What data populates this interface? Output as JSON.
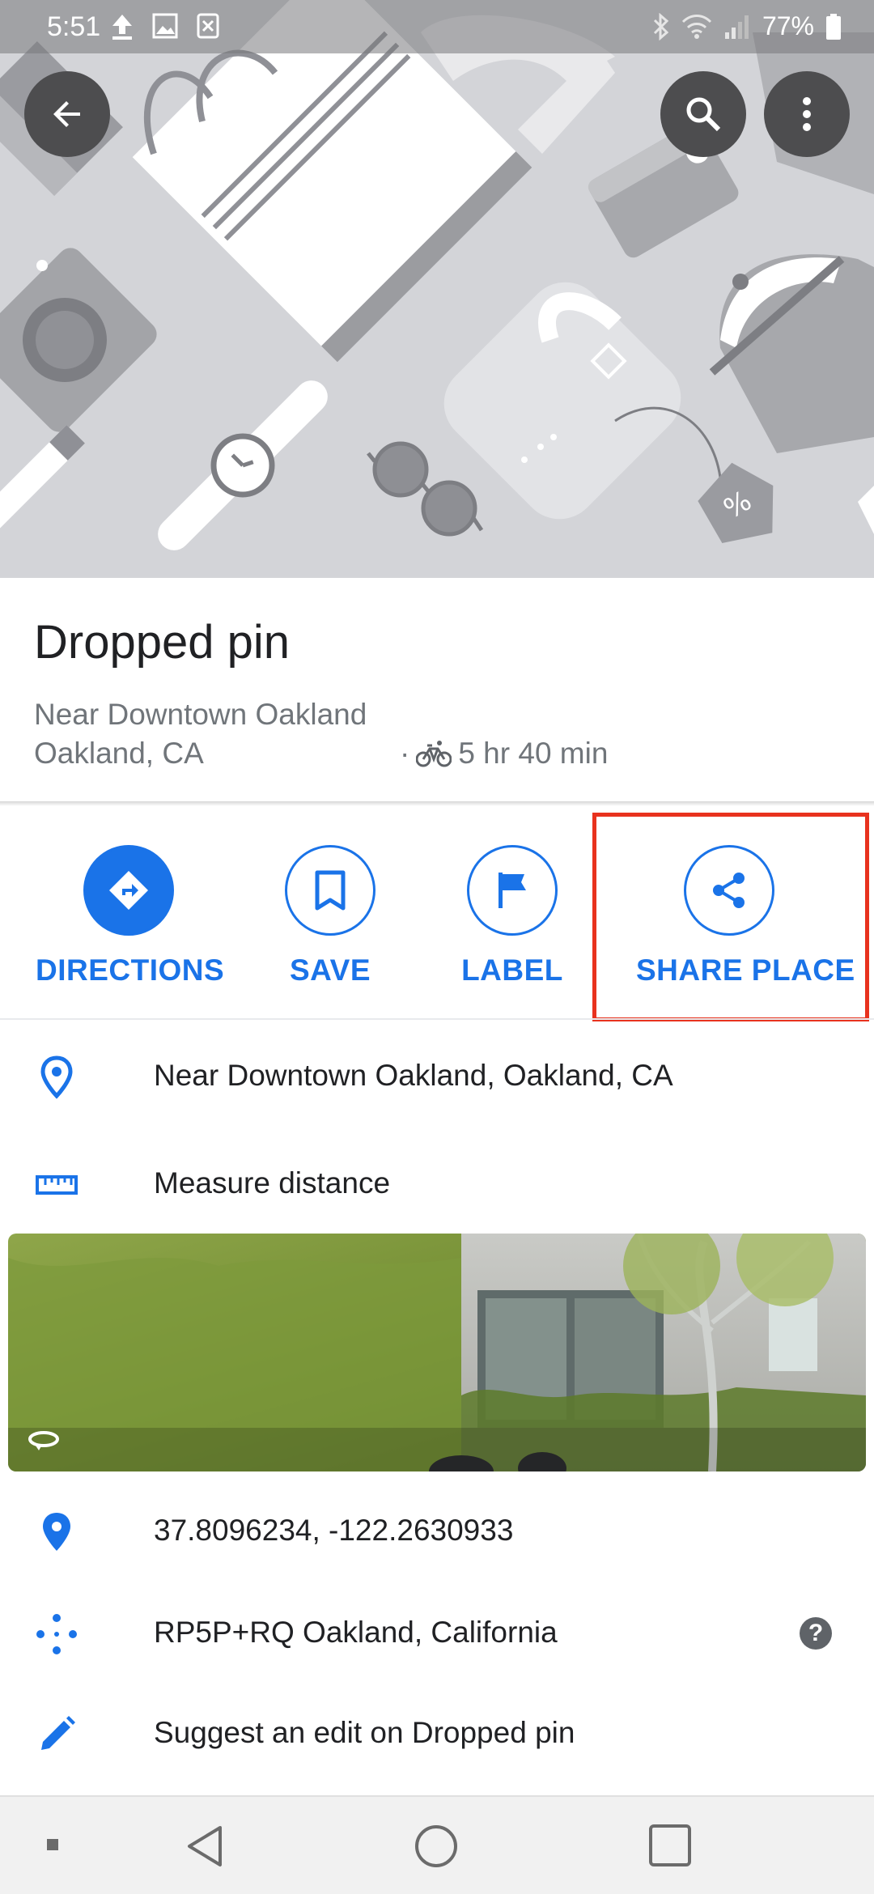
{
  "status_bar": {
    "time": "5:51",
    "battery": "77%",
    "left_icons": [
      "upload-icon",
      "image-icon",
      "close-box-icon"
    ],
    "right_icons": [
      "bluetooth-icon",
      "wifi-icon",
      "signal-icon",
      "battery-icon"
    ]
  },
  "header": {
    "back_icon": "arrow-back-icon",
    "search_icon": "search-icon",
    "more_icon": "more-vert-icon"
  },
  "place": {
    "title": "Dropped pin",
    "subtitle_line1": "Near Downtown Oakland",
    "subtitle_line2": "Oakland, CA",
    "separator": "·",
    "travel_mode_icon": "bicycle-icon",
    "travel_time": "5 hr 40 min"
  },
  "actions": [
    {
      "label": "DIRECTIONS",
      "icon": "directions-icon"
    },
    {
      "label": "SAVE",
      "icon": "bookmark-icon"
    },
    {
      "label": "LABEL",
      "icon": "flag-icon"
    },
    {
      "label": "SHARE PLACE",
      "icon": "share-icon",
      "highlighted": true
    }
  ],
  "details": {
    "address": "Near Downtown Oakland, Oakland, CA",
    "measure": "Measure distance",
    "coordinates": "37.8096234, -122.2630933",
    "plus_code": "RP5P+RQ Oakland, California",
    "help": "?",
    "suggest_edit": "Suggest an edit on Dropped pin"
  },
  "colors": {
    "accent": "#1a73e8",
    "highlight": "#e8321e",
    "text_primary": "#202124",
    "text_secondary": "#70757a"
  }
}
